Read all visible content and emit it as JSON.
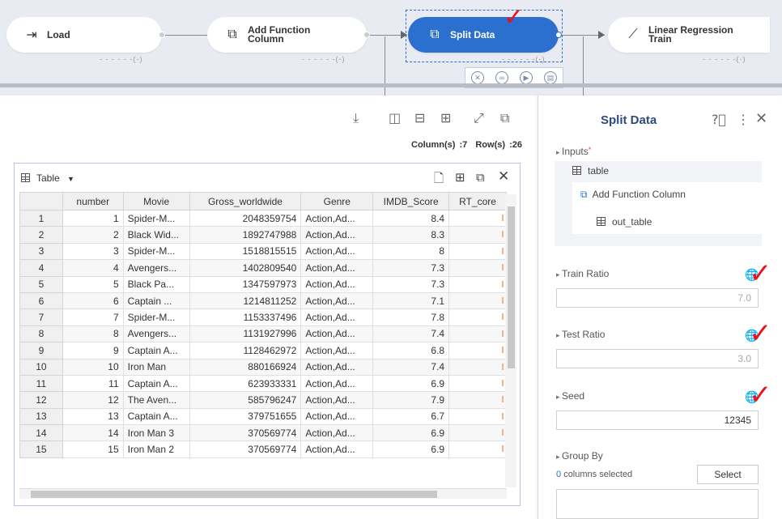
{
  "pipeline": {
    "nodes": [
      {
        "label_line1": "Load",
        "label_line2": "",
        "icon": "import-icon",
        "status": "- - - - - -(-)"
      },
      {
        "label_line1": "Add Function",
        "label_line2": "Column",
        "icon": "function-column-icon",
        "status": "- - - - - -(-)"
      },
      {
        "label_line1": "Split Data",
        "label_line2": "",
        "icon": "split-icon",
        "status": "- - - - - -(-)"
      },
      {
        "label_line1": "Linear Regression",
        "label_line2": "Train",
        "icon": "regression-chart-icon",
        "status": "- - - - - -(-)"
      }
    ],
    "tool_icons": [
      "cancel-icon",
      "link-icon",
      "run-icon",
      "delete-icon"
    ]
  },
  "toolbar": {
    "icons": [
      "download-icon",
      "columns-layout-icon",
      "rows-layout-icon",
      "grid-layout-icon",
      "expand-icon",
      "open-external-icon"
    ],
    "columns_label": "Column(s) :7",
    "rows_label": "Row(s) :26"
  },
  "table_panel": {
    "view_label": "Table",
    "icons": [
      "new-document-icon",
      "table-settings-icon",
      "copy-icon",
      "close-icon"
    ],
    "columns": [
      "",
      "number",
      "Movie",
      "Gross_worldwide",
      "Genre",
      "IMDB_Score",
      "RT_core"
    ],
    "rows": [
      [
        "1",
        "1",
        "Spider-M...",
        "2048359754",
        "Action,Ad...",
        "8.4"
      ],
      [
        "2",
        "2",
        "Black Wid...",
        "1892747988",
        "Action,Ad...",
        "8.3"
      ],
      [
        "3",
        "3",
        "Spider-M...",
        "1518815515",
        "Action,Ad...",
        "8"
      ],
      [
        "4",
        "4",
        "Avengers...",
        "1402809540",
        "Action,Ad...",
        "7.3"
      ],
      [
        "5",
        "5",
        "Black Pa...",
        "1347597973",
        "Action,Ad...",
        "7.3"
      ],
      [
        "6",
        "6",
        "Captain ...",
        "1214811252",
        "Action,Ad...",
        "7.1"
      ],
      [
        "7",
        "7",
        "Spider-M...",
        "1153337496",
        "Action,Ad...",
        "7.8"
      ],
      [
        "8",
        "8",
        "Avengers...",
        "1131927996",
        "Action,Ad...",
        "7.4"
      ],
      [
        "9",
        "9",
        "Captain A...",
        "1128462972",
        "Action,Ad...",
        "6.8"
      ],
      [
        "10",
        "10",
        "Iron Man",
        "880166924",
        "Action,Ad...",
        "7.4"
      ],
      [
        "11",
        "11",
        "Captain A...",
        "623933331",
        "Action,Ad...",
        "6.9"
      ],
      [
        "12",
        "12",
        "The Aven...",
        "585796247",
        "Action,Ad...",
        "7.9"
      ],
      [
        "13",
        "13",
        "Captain A...",
        "379751655",
        "Action,Ad...",
        "6.7"
      ],
      [
        "14",
        "14",
        "Iron Man 3",
        "370569774",
        "Action,Ad...",
        "6.9"
      ],
      [
        "15",
        "15",
        "Iron Man 2",
        "370569774",
        "Action,Ad...",
        "6.9"
      ]
    ]
  },
  "side_panel": {
    "title": "Split Data",
    "help_icon": "help-icon",
    "menu_icon": "more-vertical-icon",
    "close_icon": "close-icon",
    "inputs_label": "Inputs",
    "required_mark": "*",
    "input_table": "table",
    "input_source": "Add Function Column",
    "input_out": "out_table",
    "train_ratio_label": "Train Ratio",
    "train_ratio_value": "7.0",
    "test_ratio_label": "Test Ratio",
    "test_ratio_value": "3.0",
    "seed_label": "Seed",
    "seed_value": "12345",
    "group_by_label": "Group By",
    "columns_selected_count": "0",
    "columns_selected_text": "columns selected",
    "select_button": "Select"
  },
  "colors": {
    "accent": "#2b6fcf",
    "title": "#2d4a80",
    "checkmark": "#e8141b"
  }
}
